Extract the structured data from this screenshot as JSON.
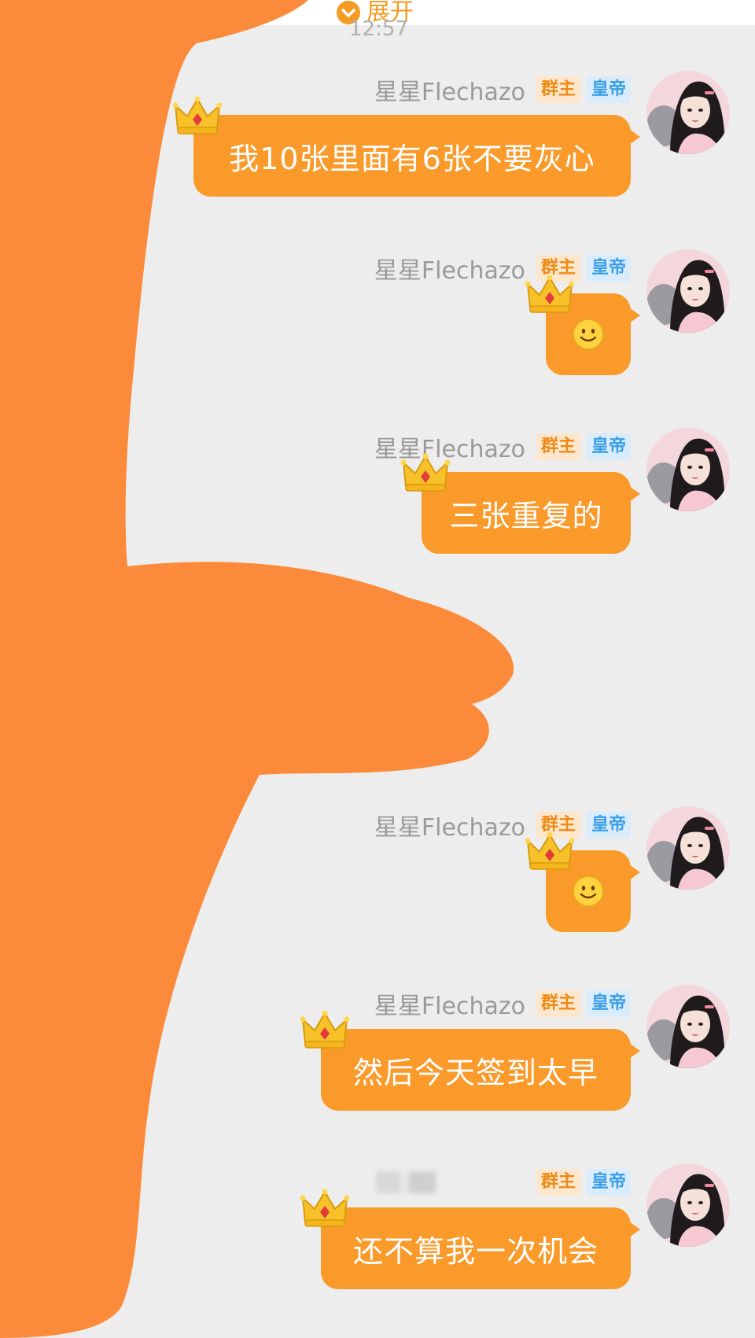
{
  "colors": {
    "bubble": "#fa9a2b",
    "accent": "#f59a23",
    "owner_badge_bg": "#fde7cc",
    "owner_badge_fg": "#ee8a16",
    "rank_badge_bg": "#d8ecfb",
    "rank_badge_fg": "#3a9ee6",
    "redaction": "#fb8a3a"
  },
  "top": {
    "expand_label": "展开",
    "expand_icon": "chevron-down-circle-icon",
    "time": "12:57"
  },
  "messages": [
    {
      "sender": "星星Flechazo",
      "owner_badge": "群主",
      "rank_badge": "皇帝",
      "type": "text",
      "text": "我10张里面有6张不要灰心"
    },
    {
      "sender": "星星Flechazo",
      "owner_badge": "群主",
      "rank_badge": "皇帝",
      "type": "emoji",
      "text": "",
      "emoji": "smiley-icon"
    },
    {
      "sender": "星星Flechazo",
      "owner_badge": "群主",
      "rank_badge": "皇帝",
      "type": "text",
      "text": "三张重复的"
    },
    {
      "sender": "星星Flechazo",
      "owner_badge": "群主",
      "rank_badge": "皇帝",
      "type": "emoji",
      "text": "",
      "emoji": "smiley-icon"
    },
    {
      "sender": "星星Flechazo",
      "owner_badge": "群主",
      "rank_badge": "皇帝",
      "type": "text",
      "text": "然后今天签到太早"
    },
    {
      "sender": "",
      "owner_badge": "群主",
      "rank_badge": "皇帝",
      "type": "text",
      "text": "还不算我一次机会",
      "sender_blurred": true
    }
  ]
}
